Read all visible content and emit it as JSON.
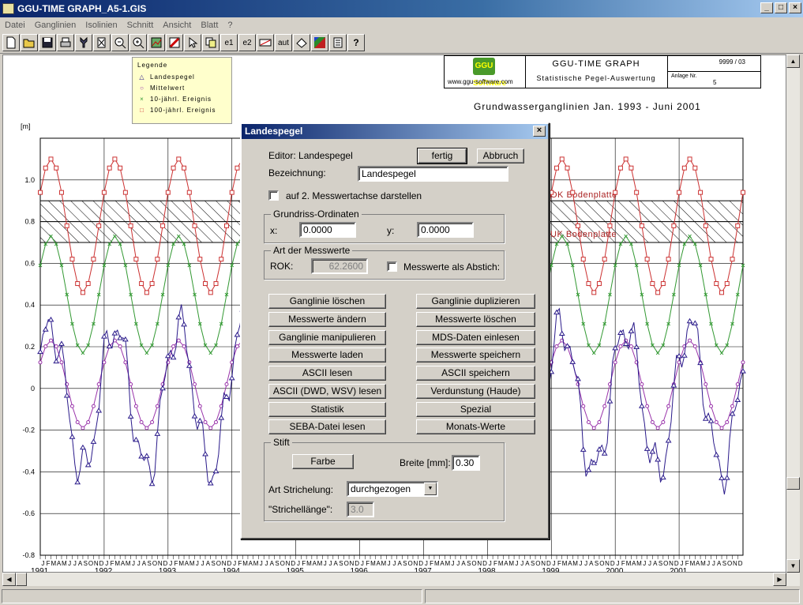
{
  "window": {
    "title": "GGU-TIME GRAPH_A5-1.GIS",
    "buttons": [
      "_",
      "□",
      "×"
    ]
  },
  "menu": [
    "Datei",
    "Ganglinien",
    "Isolinien",
    "Schnitt",
    "Ansicht",
    "Blatt",
    "?"
  ],
  "toolbar": {
    "icons": [
      "new-icon",
      "open-icon",
      "save-icon",
      "print-icon",
      "tool-icon",
      "page-zoom-icon",
      "zoom-out-icon",
      "zoom-in-icon",
      "graph-icon",
      "color-icon",
      "pointer-icon",
      "copy-icon",
      "e1",
      "e2",
      "area-icon",
      "aut",
      "print-preview-icon",
      "palette-icon",
      "list-icon",
      "help"
    ],
    "labels": {
      "e1": "e1",
      "e2": "e2",
      "aut": "aut",
      "help": "?"
    }
  },
  "legend": {
    "title": "Legende",
    "items": [
      {
        "symbol": "△",
        "label": "Landespegel",
        "color": "#2a1a8a"
      },
      {
        "symbol": "○",
        "label": "Mittelwert",
        "color": "#9933aa"
      },
      {
        "symbol": "×",
        "label": "10-jährl. Ereignis",
        "color": "#339933"
      },
      {
        "symbol": "□",
        "label": "100-jährl. Ereignis",
        "color": "#cc3333"
      }
    ]
  },
  "logo": {
    "brand": "GGU Software",
    "url": "www.ggu-software.com",
    "app": "GGU-TIME GRAPH",
    "subtitle": "Statistische Pegel-Auswertung",
    "number": "9999 / 03",
    "anlage_label": "Anlage Nr.",
    "anlage_value": "5"
  },
  "chart_data": {
    "type": "line",
    "title": "Grundwasserganglinien Jan. 1993 -  Juni 2001",
    "ylabel": "[m]",
    "ylim": [
      -0.8,
      1.2
    ],
    "yticks": [
      "1.0",
      "0.8",
      "0.6",
      "0.4",
      "0.2",
      "0",
      "-0.2",
      "-0.4",
      "-0.6",
      "-0.8"
    ],
    "years": [
      "1991",
      "1992",
      "1993",
      "1994",
      "1995",
      "1996",
      "1997",
      "1998",
      "1999",
      "2000",
      "2001"
    ],
    "month_letters": [
      "J",
      "F",
      "M",
      "A",
      "M",
      "J",
      "J",
      "A",
      "S",
      "O",
      "N",
      "D"
    ],
    "reference_lines": [
      {
        "label": "OK Bodenplatte",
        "value": 0.9
      },
      {
        "label": "UK Bodenplatte",
        "value": 0.7
      }
    ],
    "series": [
      {
        "name": "100-jährl. Ereignis",
        "color": "#cc3333",
        "marker": "square",
        "base": 0.78,
        "amp": 0.32
      },
      {
        "name": "10-jährl. Ereignis",
        "color": "#339933",
        "marker": "x",
        "base": 0.45,
        "amp": 0.28
      },
      {
        "name": "Mittelwert",
        "color": "#9933aa",
        "marker": "circle",
        "base": 0.02,
        "amp": 0.21
      },
      {
        "name": "Landespegel",
        "color": "#2a1a8a",
        "marker": "triangle",
        "base": -0.05,
        "amp": 0.35
      }
    ]
  },
  "dialog": {
    "title": "Landespegel",
    "close": "×",
    "editor_label": "Editor: Landespegel",
    "ok_button": "fertig",
    "cancel_button": "Abbruch",
    "bezeichnung_label": "Bezeichnung:",
    "bezeichnung_value": "Landespegel",
    "second_axis_label": "auf 2. Messwertachse darstellen",
    "grundriss_title": "Grundriss-Ordinaten",
    "x_label": "x:",
    "x_value": "0.0000",
    "y_label": "y:",
    "y_value": "0.0000",
    "messwerte_title": "Art der Messwerte",
    "rok_label": "ROK:",
    "rok_value": "62.2600",
    "abstich_label": "Messwerte als Abstich:",
    "buttons_left": [
      "Ganglinie löschen",
      "Messwerte ändern",
      "Ganglinie manipulieren",
      "Messwerte laden",
      "ASCII lesen",
      "ASCII (DWD, WSV) lesen",
      "Statistik",
      "SEBA-Datei lesen"
    ],
    "buttons_right": [
      "Ganglinie duplizieren",
      "Messwerte löschen",
      "MDS-Daten einlesen",
      "Messwerte speichern",
      "ASCII speichern",
      "Verdunstung (Haude)",
      "Spezial",
      "Monats-Werte"
    ],
    "stift_title": "Stift",
    "farbe_button": "Farbe",
    "breite_label": "Breite [mm]:",
    "breite_value": "0.30",
    "strichelung_label": "Art Strichelung:",
    "strichelung_value": "durchgezogen",
    "strichlaenge_label": "\"Strichellänge\":",
    "strichlaenge_value": "3.0"
  },
  "colors": {
    "titlebar": "#0a246a",
    "face": "#d4d0c8",
    "legend_bg": "#ffffcc"
  }
}
